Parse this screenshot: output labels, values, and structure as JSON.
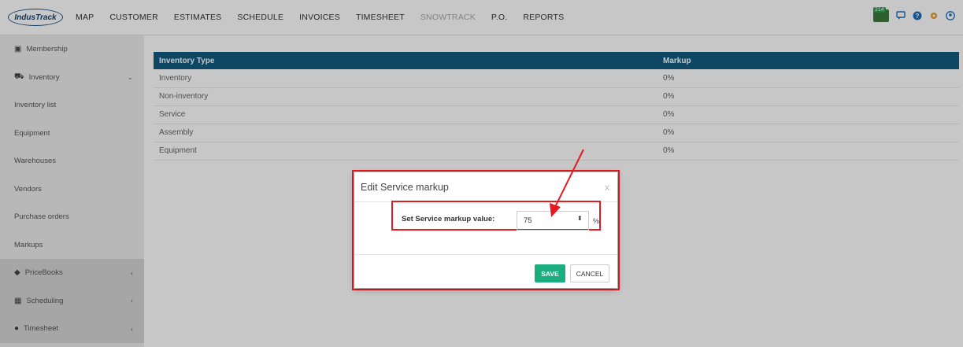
{
  "app": {
    "logo_text": "IndusTrack"
  },
  "nav": {
    "items": [
      {
        "label": "MAP"
      },
      {
        "label": "CUSTOMER"
      },
      {
        "label": "ESTIMATES"
      },
      {
        "label": "SCHEDULE"
      },
      {
        "label": "INVOICES"
      },
      {
        "label": "TIMESHEET"
      },
      {
        "label": "SNOWTRACK"
      },
      {
        "label": "P.O."
      },
      {
        "label": "REPORTS"
      }
    ],
    "notification_count": "214",
    "icons": [
      "notifications-icon",
      "chat-icon",
      "help-icon",
      "settings-icon",
      "user-icon"
    ]
  },
  "sidebar": {
    "items": [
      {
        "label": "Membership",
        "icon": "id-card-icon"
      },
      {
        "label": "Inventory",
        "icon": "truck-icon",
        "chevron": "⌄"
      },
      {
        "label": "Inventory list"
      },
      {
        "label": "Equipment"
      },
      {
        "label": "Warehouses"
      },
      {
        "label": "Vendors"
      },
      {
        "label": "Purchase orders"
      },
      {
        "label": "Markups"
      },
      {
        "label": "PriceBooks",
        "icon": "tag-icon",
        "chevron": "‹"
      },
      {
        "label": "Scheduling",
        "icon": "calendar-icon",
        "chevron": "‹"
      },
      {
        "label": "Timesheet",
        "icon": "clock-icon",
        "chevron": "‹"
      }
    ]
  },
  "table": {
    "headers": [
      "Inventory Type",
      "Markup"
    ],
    "rows": [
      [
        "Inventory",
        "0%"
      ],
      [
        "Non-inventory",
        "0%"
      ],
      [
        "Service",
        "0%"
      ],
      [
        "Assembly",
        "0%"
      ],
      [
        "Equipment",
        "0%"
      ]
    ]
  },
  "modal": {
    "title": "Edit Service markup",
    "close": "x",
    "field_label": "Set Service markup value:",
    "field_value": "75",
    "unit": "%",
    "save_label": "SAVE",
    "cancel_label": "CANCEL"
  },
  "colors": {
    "header_bg": "#135c7f",
    "save_bg": "#1aae7e",
    "highlight": "#e51b24"
  }
}
